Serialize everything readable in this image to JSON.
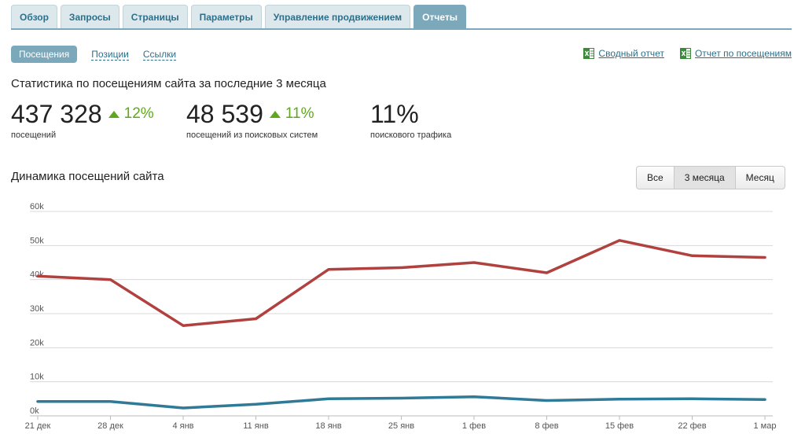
{
  "tabs": [
    {
      "label": "Обзор",
      "active": false
    },
    {
      "label": "Запросы",
      "active": false
    },
    {
      "label": "Страницы",
      "active": false
    },
    {
      "label": "Параметры",
      "active": false
    },
    {
      "label": "Управление продвижением",
      "active": false
    },
    {
      "label": "Отчеты",
      "active": true
    }
  ],
  "subnav": {
    "active": "Посещения",
    "positions": "Позиции",
    "links": "Ссылки"
  },
  "reports": {
    "summary": "Сводный отчет",
    "visits": "Отчет по посещениям",
    "icon": "excel-icon"
  },
  "stats": {
    "title": "Статистика по посещениям сайта за последние 3 месяца",
    "visits": {
      "value": "437 328",
      "change": "12%",
      "caption": "посещений"
    },
    "search_visits": {
      "value": "48 539",
      "change": "11%",
      "caption": "посещений из поисковых систем"
    },
    "search_share": {
      "value": "11%",
      "caption": "поискового трафика"
    }
  },
  "chart_title": "Динамика посещений сайта",
  "range_buttons": {
    "all": "Все",
    "three_months": "3 месяца",
    "month": "Месяц",
    "selected": "3 месяца"
  },
  "colors": {
    "accent": "#7ba9bb",
    "up": "#5fa81e",
    "series_visits": "#b0413e",
    "series_search": "#2f7a96"
  },
  "chart_data": {
    "type": "line",
    "categories": [
      "21 дек",
      "28 дек",
      "4 янв",
      "11 янв",
      "18 янв",
      "25 янв",
      "1 фев",
      "8 фев",
      "15 фев",
      "22 фев",
      "1 мар"
    ],
    "series": [
      {
        "values": [
          41000,
          40000,
          26500,
          28500,
          43000,
          43500,
          45000,
          42000,
          51500,
          47000,
          46500
        ],
        "color": "#b0413e"
      },
      {
        "values": [
          4200,
          4200,
          2300,
          3400,
          5000,
          5200,
          5600,
          4500,
          4900,
          5000,
          4800
        ],
        "color": "#2f7a96"
      }
    ],
    "yticks": [
      "0k",
      "10k",
      "20k",
      "30k",
      "40k",
      "50k",
      "60k"
    ],
    "ylim": [
      0,
      60000
    ],
    "grid": true
  }
}
